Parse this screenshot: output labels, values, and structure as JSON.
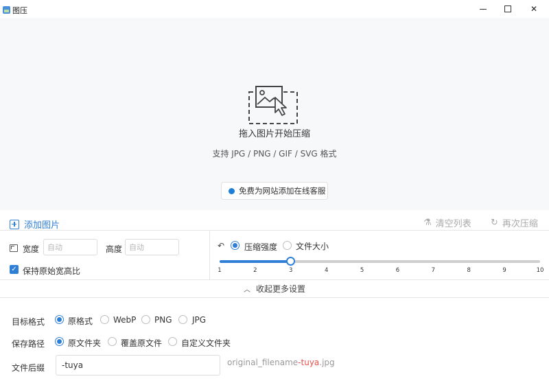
{
  "window": {
    "title": "图压"
  },
  "dropzone": {
    "main_text": "拖入图片开始压缩",
    "sub_text": "支持 JPG / PNG / GIF / SVG 格式",
    "service_button": "免费为网站添加在线客服"
  },
  "toolbar": {
    "add_label": "添加图片",
    "clear_label": "清空列表",
    "retry_label": "再次压缩"
  },
  "size": {
    "width_label": "宽度",
    "width_placeholder": "自动",
    "height_label": "高度",
    "height_placeholder": "自动",
    "keep_ratio_label": "保持原始宽高比",
    "keep_ratio_checked": true
  },
  "compression": {
    "mode_options": [
      "压缩强度",
      "文件大小"
    ],
    "selected_mode": "压缩强度",
    "level": 3,
    "min": 1,
    "max": 10,
    "ticks": [
      "1",
      "2",
      "3",
      "4",
      "5",
      "6",
      "7",
      "8",
      "9",
      "10"
    ]
  },
  "collapse": {
    "label": "收起更多设置"
  },
  "format": {
    "label": "目标格式",
    "options": [
      "原格式",
      "WebP",
      "PNG",
      "JPG"
    ],
    "selected": "原格式"
  },
  "save_path": {
    "label": "保存路径",
    "options": [
      "原文件夹",
      "覆盖原文件",
      "自定义文件夹"
    ],
    "selected": "原文件夹"
  },
  "suffix": {
    "label": "文件后缀",
    "value": "-tuya",
    "hint_prefix": "original_filename",
    "hint_accent": "-tuya",
    "hint_suffix": ".jpg"
  },
  "colors": {
    "accent": "#2f7fd6",
    "hint_accent": "#e8514b",
    "dropzone_bg": "#f7f8fa"
  },
  "icons": [
    "app-icon",
    "image-drop-icon",
    "add-icon",
    "flask-icon",
    "refresh-icon",
    "resize-icon",
    "check-icon",
    "compress-mode-icon",
    "chevron-up-icon"
  ]
}
